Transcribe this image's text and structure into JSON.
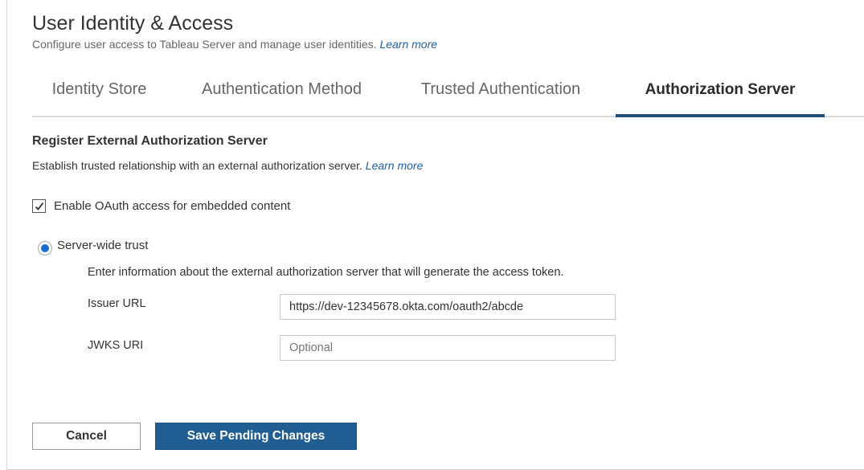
{
  "header": {
    "title": "User Identity & Access",
    "subtitle": "Configure user access to Tableau Server and manage user identities.",
    "subtitle_link": "Learn more"
  },
  "tabs": [
    {
      "label": "Identity Store",
      "active": false
    },
    {
      "label": "Authentication Method",
      "active": false
    },
    {
      "label": "Trusted Authentication",
      "active": false
    },
    {
      "label": "Authorization Server",
      "active": true
    }
  ],
  "section": {
    "title": "Register External Authorization Server",
    "description": "Establish trusted relationship with an external authorization server.",
    "description_link": "Learn more"
  },
  "oauth_checkbox": {
    "label": "Enable OAuth access for embedded content",
    "checked": true
  },
  "server_wide_radio": {
    "label": "Server-wide trust",
    "selected": true
  },
  "server_info": {
    "text": "Enter information about the external authorization server that will generate the access token.",
    "issuer_label": "Issuer URL",
    "issuer_value": "https://dev-12345678.okta.com/oauth2/abcde",
    "jwks_label": "JWKS URI",
    "jwks_placeholder": "Optional"
  },
  "actions": {
    "cancel_label": "Cancel",
    "save_label": "Save Pending Changes"
  },
  "colors": {
    "accent": "#1f5d93",
    "active_tab_underline": "#1f4e79",
    "link": "#1f5fa0",
    "radio": "#1b6ccf"
  }
}
